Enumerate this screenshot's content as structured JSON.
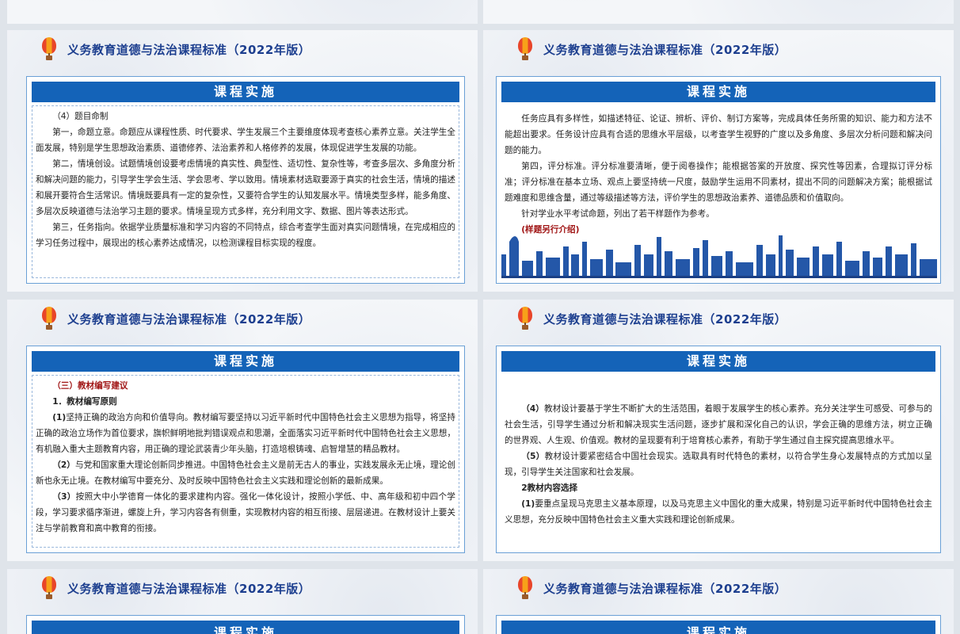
{
  "header_title": "义务教育道德与法治课程标准（2022年版）",
  "band_title": "课程实施",
  "slides": {
    "s1": {
      "heading": "（4）题目命制",
      "p1": "第一，命题立意。命题应从课程性质、时代要求、学生发展三个主要维度体现考查核心素养立意。关注学生全面发展，特别是学生思想政治素质、道德修养、法治素养和人格修养的发展，体现促进学生发展的功能。",
      "p2": "第二，情境创设。试题情境创设要考虑情境的真实性、典型性、适切性、复杂性等，考查多层次、多角度分析和解决问题的能力，引导学生学会生活、学会思考、学以致用。情境素材选取要源于真实的社会生活，情境的描述和展开要符合生活常识。情境既要具有一定的复杂性，又要符合学生的认知发展水平。情境类型多样，能多角度、多层次反映道德与法治学习主题的要求。情境呈现方式多样，充分利用文字、数据、图片等表达形式。",
      "p3": "第三，任务指向。依据学业质量标准和学习内容的不同特点，综合考查学生面对真实问题情境，在完成相应的学习任务过程中，展现出的核心素养达成情况，以检测课程目标实现的程度。"
    },
    "s2": {
      "p1": "任务应具有多样性，如描述特征、论证、辨析、评价、制订方案等，完成具体任务所需的知识、能力和方法不能超出要求。任务设计应具有合适的思维水平层级，以考查学生视野的广度以及多角度、多层次分析问题和解决问题的能力。",
      "p2": "第四，评分标准。评分标准要清晰，便于阅卷操作；能根据答案的开放度、探究性等因素，合理拟订评分标准；评分标准在基本立场、观点上要坚持统一尺度，鼓励学生运用不同素材，提出不同的问题解决方案；能根据试题难度和思维含量，通过等级描述等方法，评价学生的思想政治素养、道德品质和价值取向。",
      "p3": "针对学业水平考试命题，列出了若干样题作为参考。",
      "note": "(样题另行介绍)"
    },
    "s3": {
      "section": "（三）教材编写建议",
      "sub": "1．教材编写原则",
      "p1_lead": "(1)",
      "p1": "坚持正确的政治方向和价值导向。教材编写要坚持以习近平新时代中国特色社会主义思想为指导，将坚持正确的政治立场作为首位要求，旗帜鲜明地批判错误观点和思潮，全面落实习近平新时代中国特色社会主义思想，有机融入重大主题教育内容，用正确的理论武装青少年头脑，打造培根铸魂、启智增慧的精品教材。",
      "p2_lead": "（2）",
      "p2": "与党和国家重大理论创新同步推进。中国特色社会主义是前无古人的事业，实践发展永无止境，理论创新也永无止境。在教材编写中要充分、及时反映中国特色社会主义实践和理论创新的最新成果。",
      "p3_lead": "（3）",
      "p3": "按照大中小学德育一体化的要求建构内容。强化一体化设计，按照小学低、中、高年级和初中四个学段，学习要求循序渐进，螺旋上升，学习内容各有侧重，实现教材内容的相互衔接、层层递进。在教材设计上要关注与学前教育和高中教育的衔接。"
    },
    "s4": {
      "p1_lead": "（4）",
      "p1": "教材设计要基于学生不断扩大的生活范围，着眼于发展学生的核心素养。充分关注学生可感受、可参与的社会生活，引导学生通过分析和解决现实生活问题，逐步扩展和深化自己的认识，学会正确的思维方法，树立正确的世界观、人生观、价值观。教材的呈现要有利于培育核心素养，有助于学生通过自主探究提高思维水平。",
      "p2_lead": "（5）",
      "p2": "教材设计要紧密结合中国社会现实。选取具有时代特色的素材，以符合学生身心发展特点的方式加以呈现，引导学生关注国家和社会发展。",
      "sub": "2教材内容选择",
      "p3_lead": "(1)",
      "p3": "要重点呈现马克思主义基本原理，以及马克思主义中国化的重大成果，特别是习近平新时代中国特色社会主义思想，充分反映中国特色社会主义重大实践和理论创新成果。"
    }
  }
}
